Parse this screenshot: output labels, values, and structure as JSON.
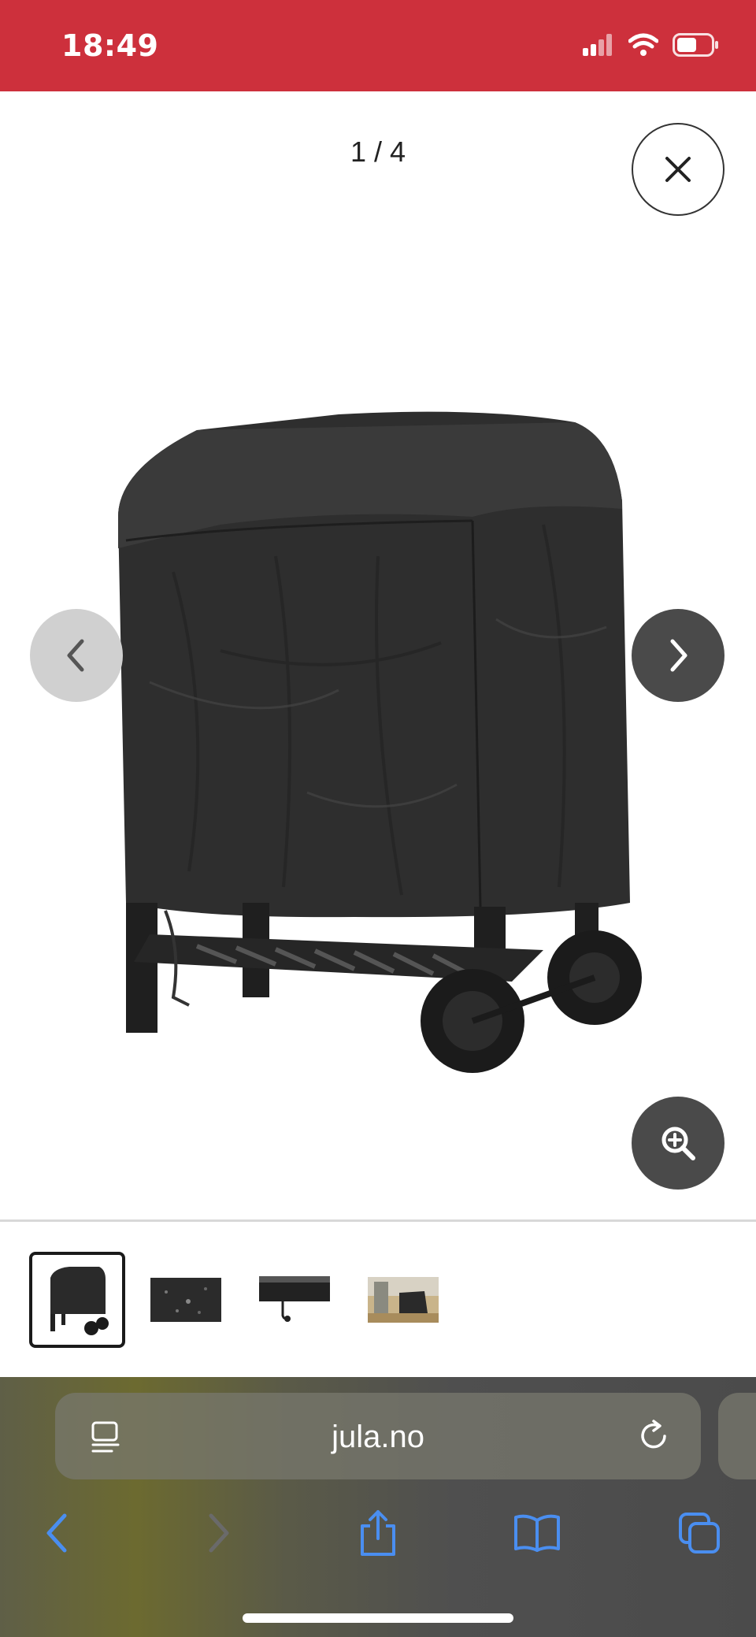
{
  "status_bar": {
    "time": "18:49",
    "background": "#cd303c"
  },
  "gallery": {
    "counter": "1 / 4",
    "image_alt": "Grill cover on grill with wheels",
    "icons": {
      "close": "close-icon",
      "prev": "chevron-left-icon",
      "next": "chevron-right-icon",
      "zoom": "zoom-in-icon"
    }
  },
  "thumbnails": {
    "items": [
      {
        "name": "thumbnail-1",
        "active": true
      },
      {
        "name": "thumbnail-2",
        "active": false
      },
      {
        "name": "thumbnail-3",
        "active": false
      },
      {
        "name": "thumbnail-4",
        "active": false
      }
    ]
  },
  "browser": {
    "url": "jula.no",
    "icons": [
      "reader-icon",
      "reload-icon",
      "back-icon",
      "forward-icon",
      "share-icon",
      "bookmarks-icon",
      "tabs-icon"
    ],
    "accent": "#4a8ef0"
  }
}
